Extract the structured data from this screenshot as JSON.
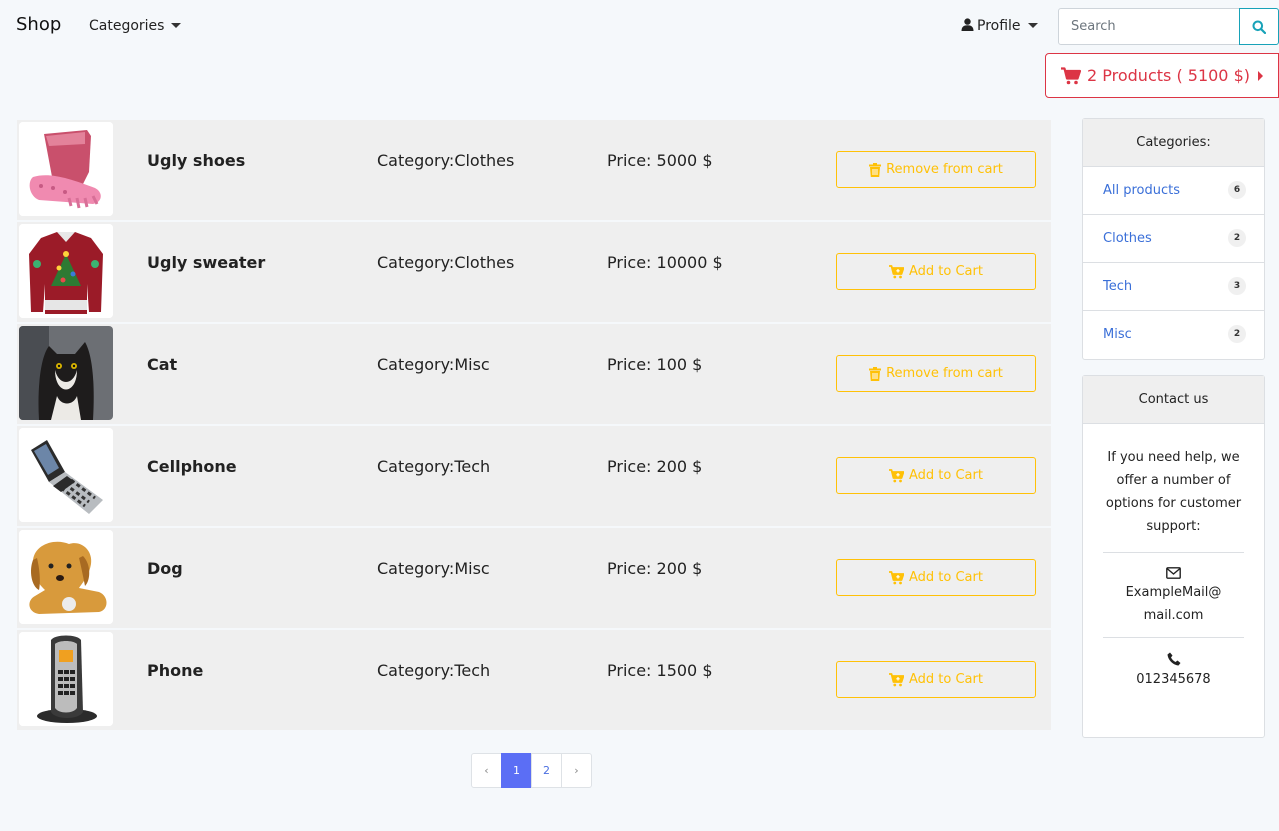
{
  "navbar": {
    "brand": "Shop",
    "categories_label": "Categories",
    "profile_label": "Profile",
    "search_placeholder": "Search"
  },
  "cart": {
    "label": "2 Products ( 5100 $)"
  },
  "products": [
    {
      "name": "Ugly shoes",
      "category": "Category:Clothes",
      "price": "Price: 5000 $",
      "action": "Remove from cart",
      "icon": "trash-icon"
    },
    {
      "name": "Ugly sweater",
      "category": "Category:Clothes",
      "price": "Price: 10000 $",
      "action": "Add to Cart",
      "icon": "cart-plus-icon"
    },
    {
      "name": "Cat",
      "category": "Category:Misc",
      "price": "Price: 100 $",
      "action": "Remove from cart",
      "icon": "trash-icon"
    },
    {
      "name": "Cellphone",
      "category": "Category:Tech",
      "price": "Price: 200 $",
      "action": "Add to Cart",
      "icon": "cart-plus-icon"
    },
    {
      "name": "Dog",
      "category": "Category:Misc",
      "price": "Price: 200 $",
      "action": "Add to Cart",
      "icon": "cart-plus-icon"
    },
    {
      "name": "Phone",
      "category": "Category:Tech",
      "price": "Price: 1500 $",
      "action": "Add to Cart",
      "icon": "cart-plus-icon"
    }
  ],
  "pagination": {
    "prev": "‹",
    "pages": [
      "1",
      "2"
    ],
    "current": "1",
    "next": "›"
  },
  "sidebar": {
    "categories_title": "Categories:",
    "categories": [
      {
        "label": "All products",
        "count": "6"
      },
      {
        "label": "Clothes",
        "count": "2"
      },
      {
        "label": "Tech",
        "count": "3"
      },
      {
        "label": "Misc",
        "count": "2"
      }
    ],
    "contact_title": "Contact us",
    "contact_text": "If you need help, we offer a number of options for customer support:",
    "email": "ExampleMail@ mail.com",
    "phone": "012345678"
  },
  "colors": {
    "warning": "#ffc107",
    "danger": "#dc3545",
    "info": "#17a2b8",
    "primary": "#5b6ef5"
  }
}
